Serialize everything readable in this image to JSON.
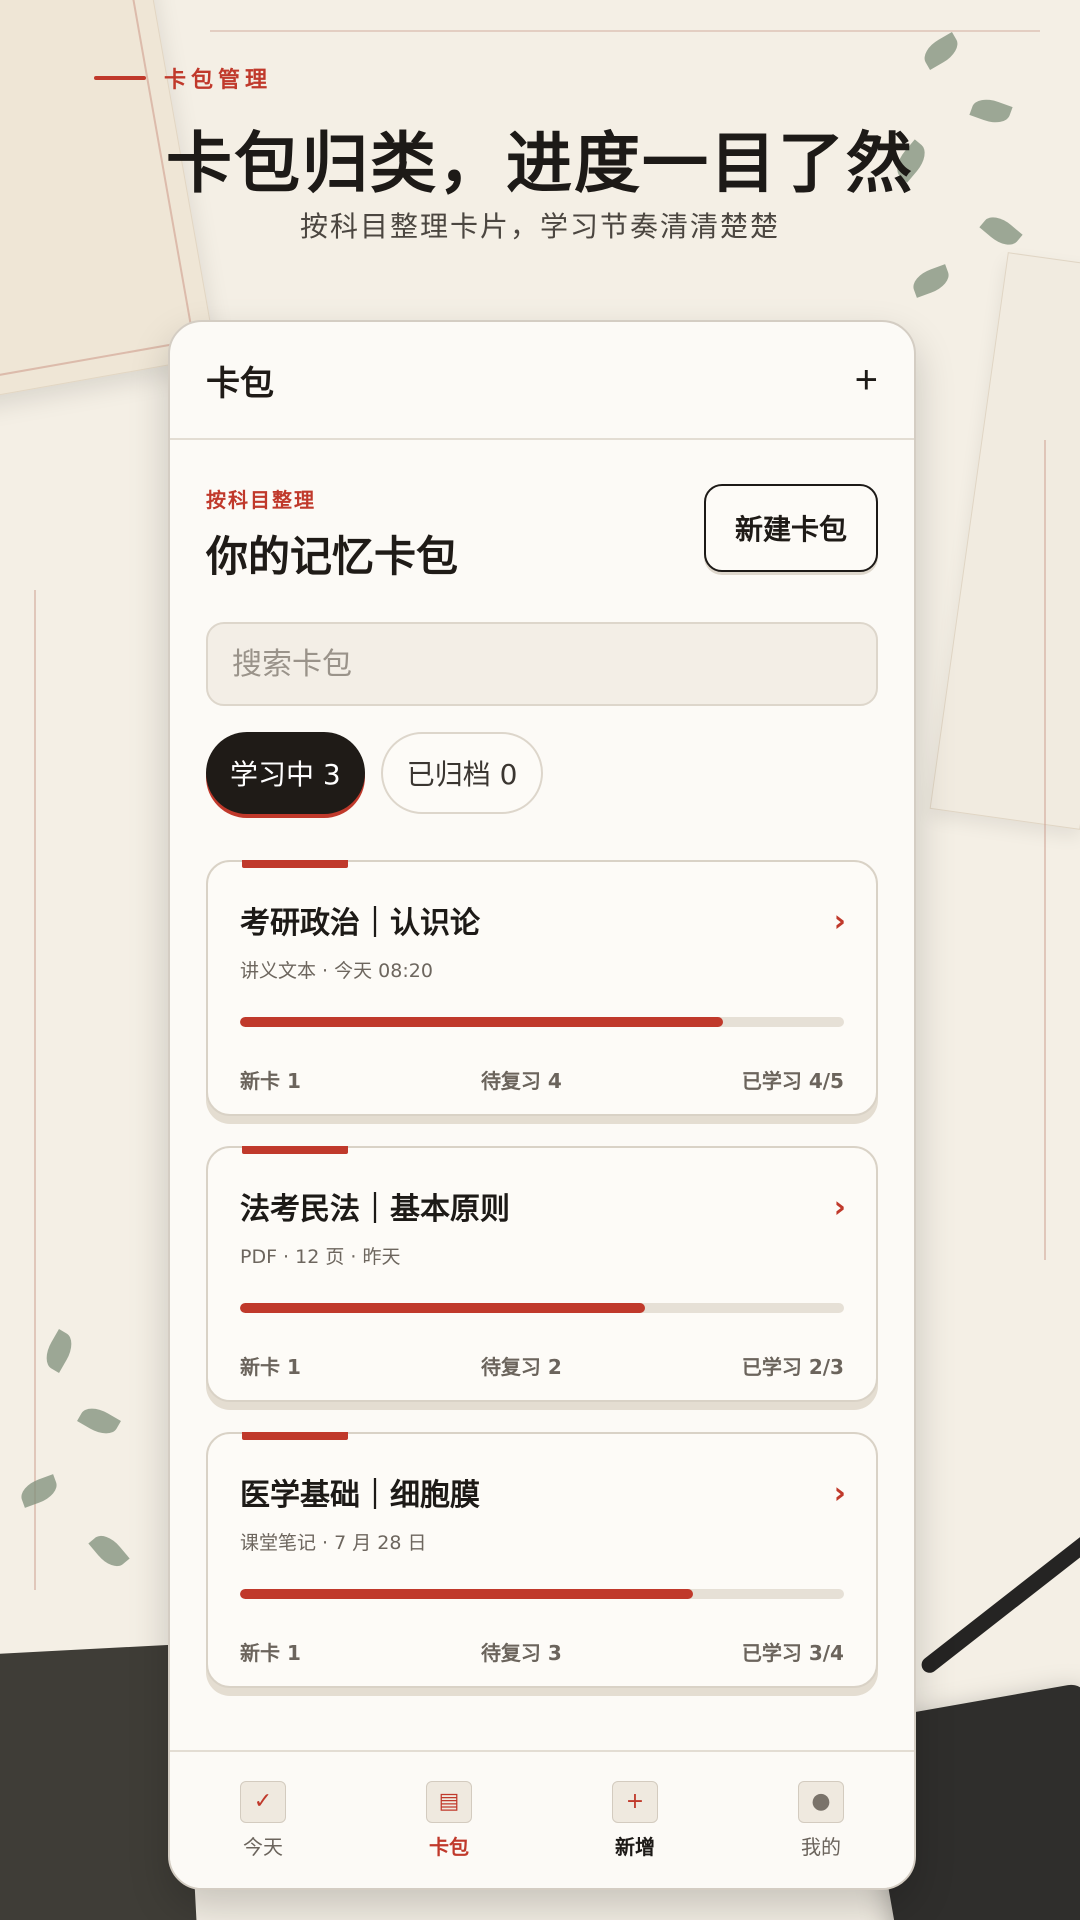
{
  "hero": {
    "eyebrow": "卡包管理",
    "headline": "卡包归类，进度一目了然",
    "subline": "按科目整理卡片，学习节奏清清楚楚"
  },
  "appbar": {
    "title": "卡包",
    "add_label": "+"
  },
  "section": {
    "tag": "按科目整理",
    "title": "你的记忆卡包",
    "new_pack_label": "新建卡包"
  },
  "search": {
    "placeholder": "搜索卡包",
    "value": ""
  },
  "tabs": [
    {
      "label": "学习中 3",
      "active": true
    },
    {
      "label": "已归档 0",
      "active": false
    }
  ],
  "packs": [
    {
      "title": "考研政治｜认识论",
      "meta": "讲义文本 · 今天 08:20",
      "progress": 0.8,
      "new": "新卡 1",
      "review": "待复习 4",
      "learned": "已学习 4/5"
    },
    {
      "title": "法考民法｜基本原则",
      "meta": "PDF · 12 页 · 昨天",
      "progress": 0.67,
      "new": "新卡 1",
      "review": "待复习 2",
      "learned": "已学习 2/3"
    },
    {
      "title": "医学基础｜细胞膜",
      "meta": "课堂笔记 · 7 月 28 日",
      "progress": 0.75,
      "new": "新卡 1",
      "review": "待复习 3",
      "learned": "已学习 3/4"
    }
  ],
  "nav": [
    {
      "label": "今天",
      "icon": "calendar-check-icon",
      "state": "normal"
    },
    {
      "label": "卡包",
      "icon": "card-pack-icon",
      "state": "active"
    },
    {
      "label": "新增",
      "icon": "add-card-icon",
      "state": "add"
    },
    {
      "label": "我的",
      "icon": "profile-icon",
      "state": "normal"
    }
  ],
  "colors": {
    "accent": "#c0392b",
    "ink": "#1f1b17",
    "paper": "#fcfaf6"
  }
}
